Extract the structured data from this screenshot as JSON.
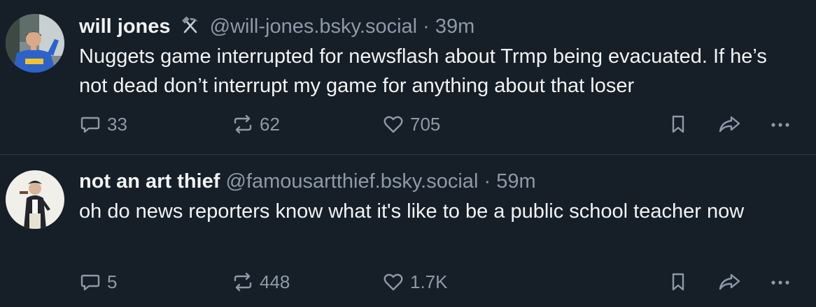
{
  "posts": [
    {
      "display_name": "will jones",
      "name_emoji": "hammer-and-pick-icon",
      "handle": "@will-jones.bsky.social",
      "separator": "·",
      "time": "39m",
      "text": "Nuggets game interrupted for newsflash about Trmp being evacuated. If he’s not dead don’t interrupt my game for anything about that loser",
      "replies": "33",
      "reposts": "62",
      "likes": "705"
    },
    {
      "display_name": "not an art thief",
      "handle": "@famousartthief.bsky.social",
      "separator": "·",
      "time": "59m",
      "text": "oh do news reporters know what it's like to be a public school teacher now",
      "replies": "5",
      "reposts": "448",
      "likes": "1.7K"
    }
  ],
  "colors": {
    "background": "#161e27",
    "text": "#f1f3f5",
    "muted": "#8d9aa8",
    "divider": "#2e3a47"
  }
}
